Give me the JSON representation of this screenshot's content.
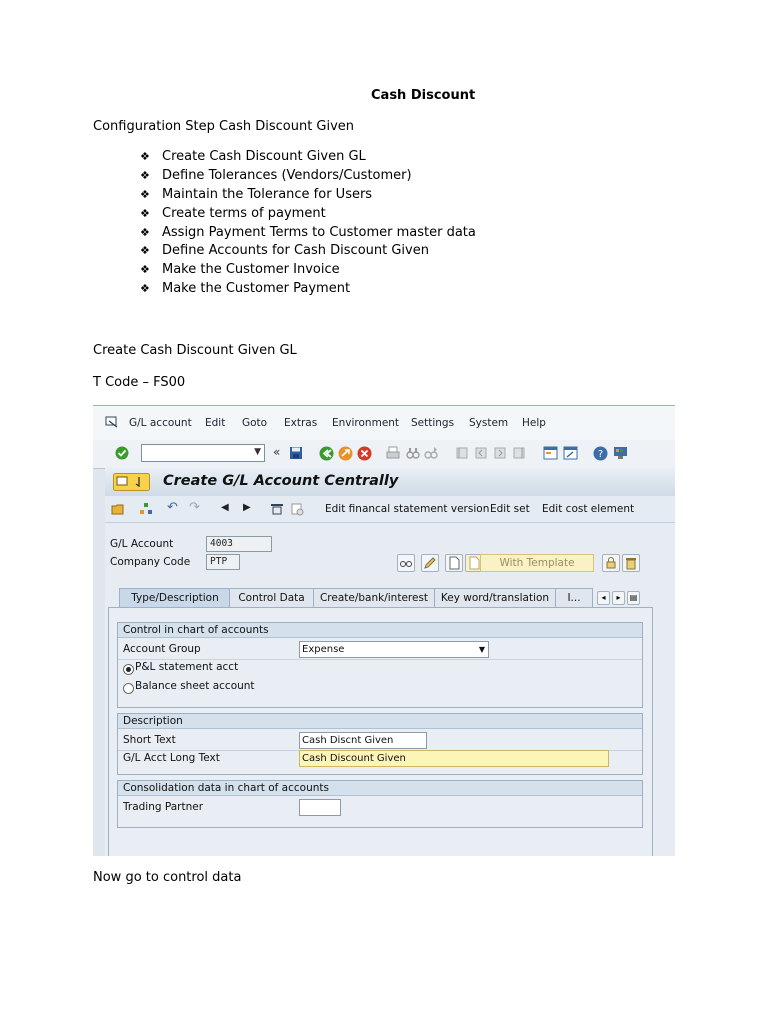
{
  "document": {
    "title": "Cash Discount",
    "intro": "Configuration Step Cash Discount Given",
    "bullet_symbol": "❖",
    "steps": [
      "Create Cash Discount Given GL",
      "Define Tolerances (Vendors/Customer)",
      "Maintain the Tolerance for Users",
      "Create terms of payment",
      "Assign Payment Terms to Customer master data",
      "Define Accounts for Cash Discount Given",
      "Make the Customer Invoice",
      "Make the Customer Payment"
    ],
    "section_heading": "Create Cash Discount Given GL",
    "tcode": "T Code – FS00",
    "footer": "Now go to control data"
  },
  "sap": {
    "menu": [
      "G/L account",
      "Edit",
      "Goto",
      "Extras",
      "Environment",
      "Settings",
      "System",
      "Help"
    ],
    "command_field_value": "",
    "screen_title": "Create G/L Account Centrally",
    "app_toolbar": {
      "edit_fs_version": "Edit financal statement version",
      "edit_set": "Edit set",
      "edit_cost_element": "Edit cost element"
    },
    "gl_account": {
      "label": "G/L Account",
      "value": "4003"
    },
    "company_code": {
      "label": "Company Code",
      "value": "PTP"
    },
    "with_template": "With Template",
    "tabs": [
      "Type/Description",
      "Control Data",
      "Create/bank/interest",
      "Key word/translation",
      "I..."
    ],
    "active_tab": "Type/Description",
    "groups": {
      "control": {
        "title": "Control in chart of accounts",
        "account_group_label": "Account Group",
        "account_group_value": "Expense",
        "radio_pl": "P&L statement acct",
        "radio_bs": "Balance sheet account",
        "selected": "P&L statement acct"
      },
      "description": {
        "title": "Description",
        "short_text_label": "Short Text",
        "short_text_value": "Cash Discnt Given",
        "long_text_label": "G/L Acct Long Text",
        "long_text_value": "Cash Discount Given"
      },
      "consolidation": {
        "title": "Consolidation data in chart of accounts",
        "trading_partner_label": "Trading Partner",
        "trading_partner_value": ""
      }
    },
    "colors": {
      "accent_green": "#3a9a2e",
      "accent_orange": "#e8922a",
      "accent_red": "#d23a2a",
      "highlight": "#fdf4b8"
    }
  }
}
